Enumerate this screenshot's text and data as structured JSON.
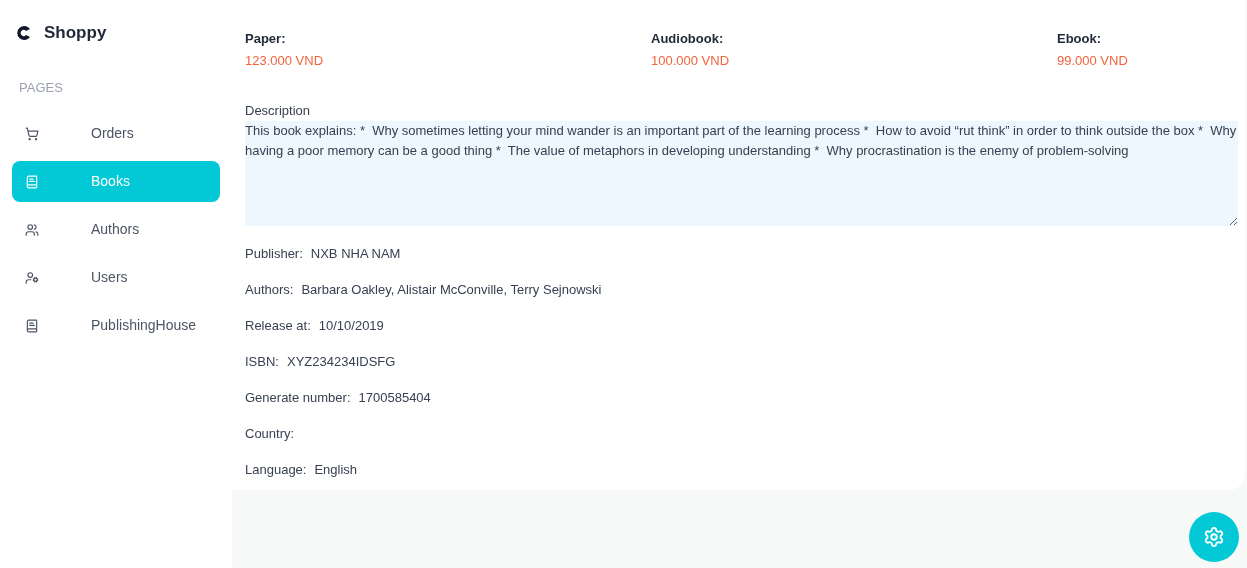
{
  "brand": {
    "name": "Shoppy"
  },
  "sidebar": {
    "section": "PAGES",
    "items": [
      {
        "label": "Orders",
        "kind": "cart",
        "selected": false
      },
      {
        "label": "Books",
        "kind": "book",
        "selected": true
      },
      {
        "label": "Authors",
        "kind": "group",
        "selected": false
      },
      {
        "label": "Users",
        "kind": "userlist",
        "selected": false
      },
      {
        "label": "PublishingHouse",
        "kind": "book",
        "selected": false
      }
    ]
  },
  "prices": [
    {
      "label": "Paper:",
      "value": "123.000 VND"
    },
    {
      "label": "Audiobook:",
      "value": "100.000 VND"
    },
    {
      "label": "Ebook:",
      "value": "99.000 VND"
    }
  ],
  "description": {
    "label": "Description",
    "value": "This book explains: *  Why sometimes letting your mind wander is an important part of the learning process *  How to avoid “rut think” in order to think outside the box *  Why having a poor memory can be a good thing *  The value of metaphors in developing understanding *  Why procrastination is the enemy of problem-solving"
  },
  "details": [
    {
      "label": "Publisher:",
      "value": "NXB NHA NAM"
    },
    {
      "label": "Authors:",
      "value": "Barbara Oakley, Alistair McConville, Terry Sejnowski"
    },
    {
      "label": "Release at:",
      "value": "10/10/2019"
    },
    {
      "label": "ISBN:",
      "value": "XYZ234234IDSFG"
    },
    {
      "label": "Generate number:",
      "value": "1700585404"
    },
    {
      "label": "Country:"
    },
    {
      "label": "Language:",
      "value": "English"
    }
  ]
}
